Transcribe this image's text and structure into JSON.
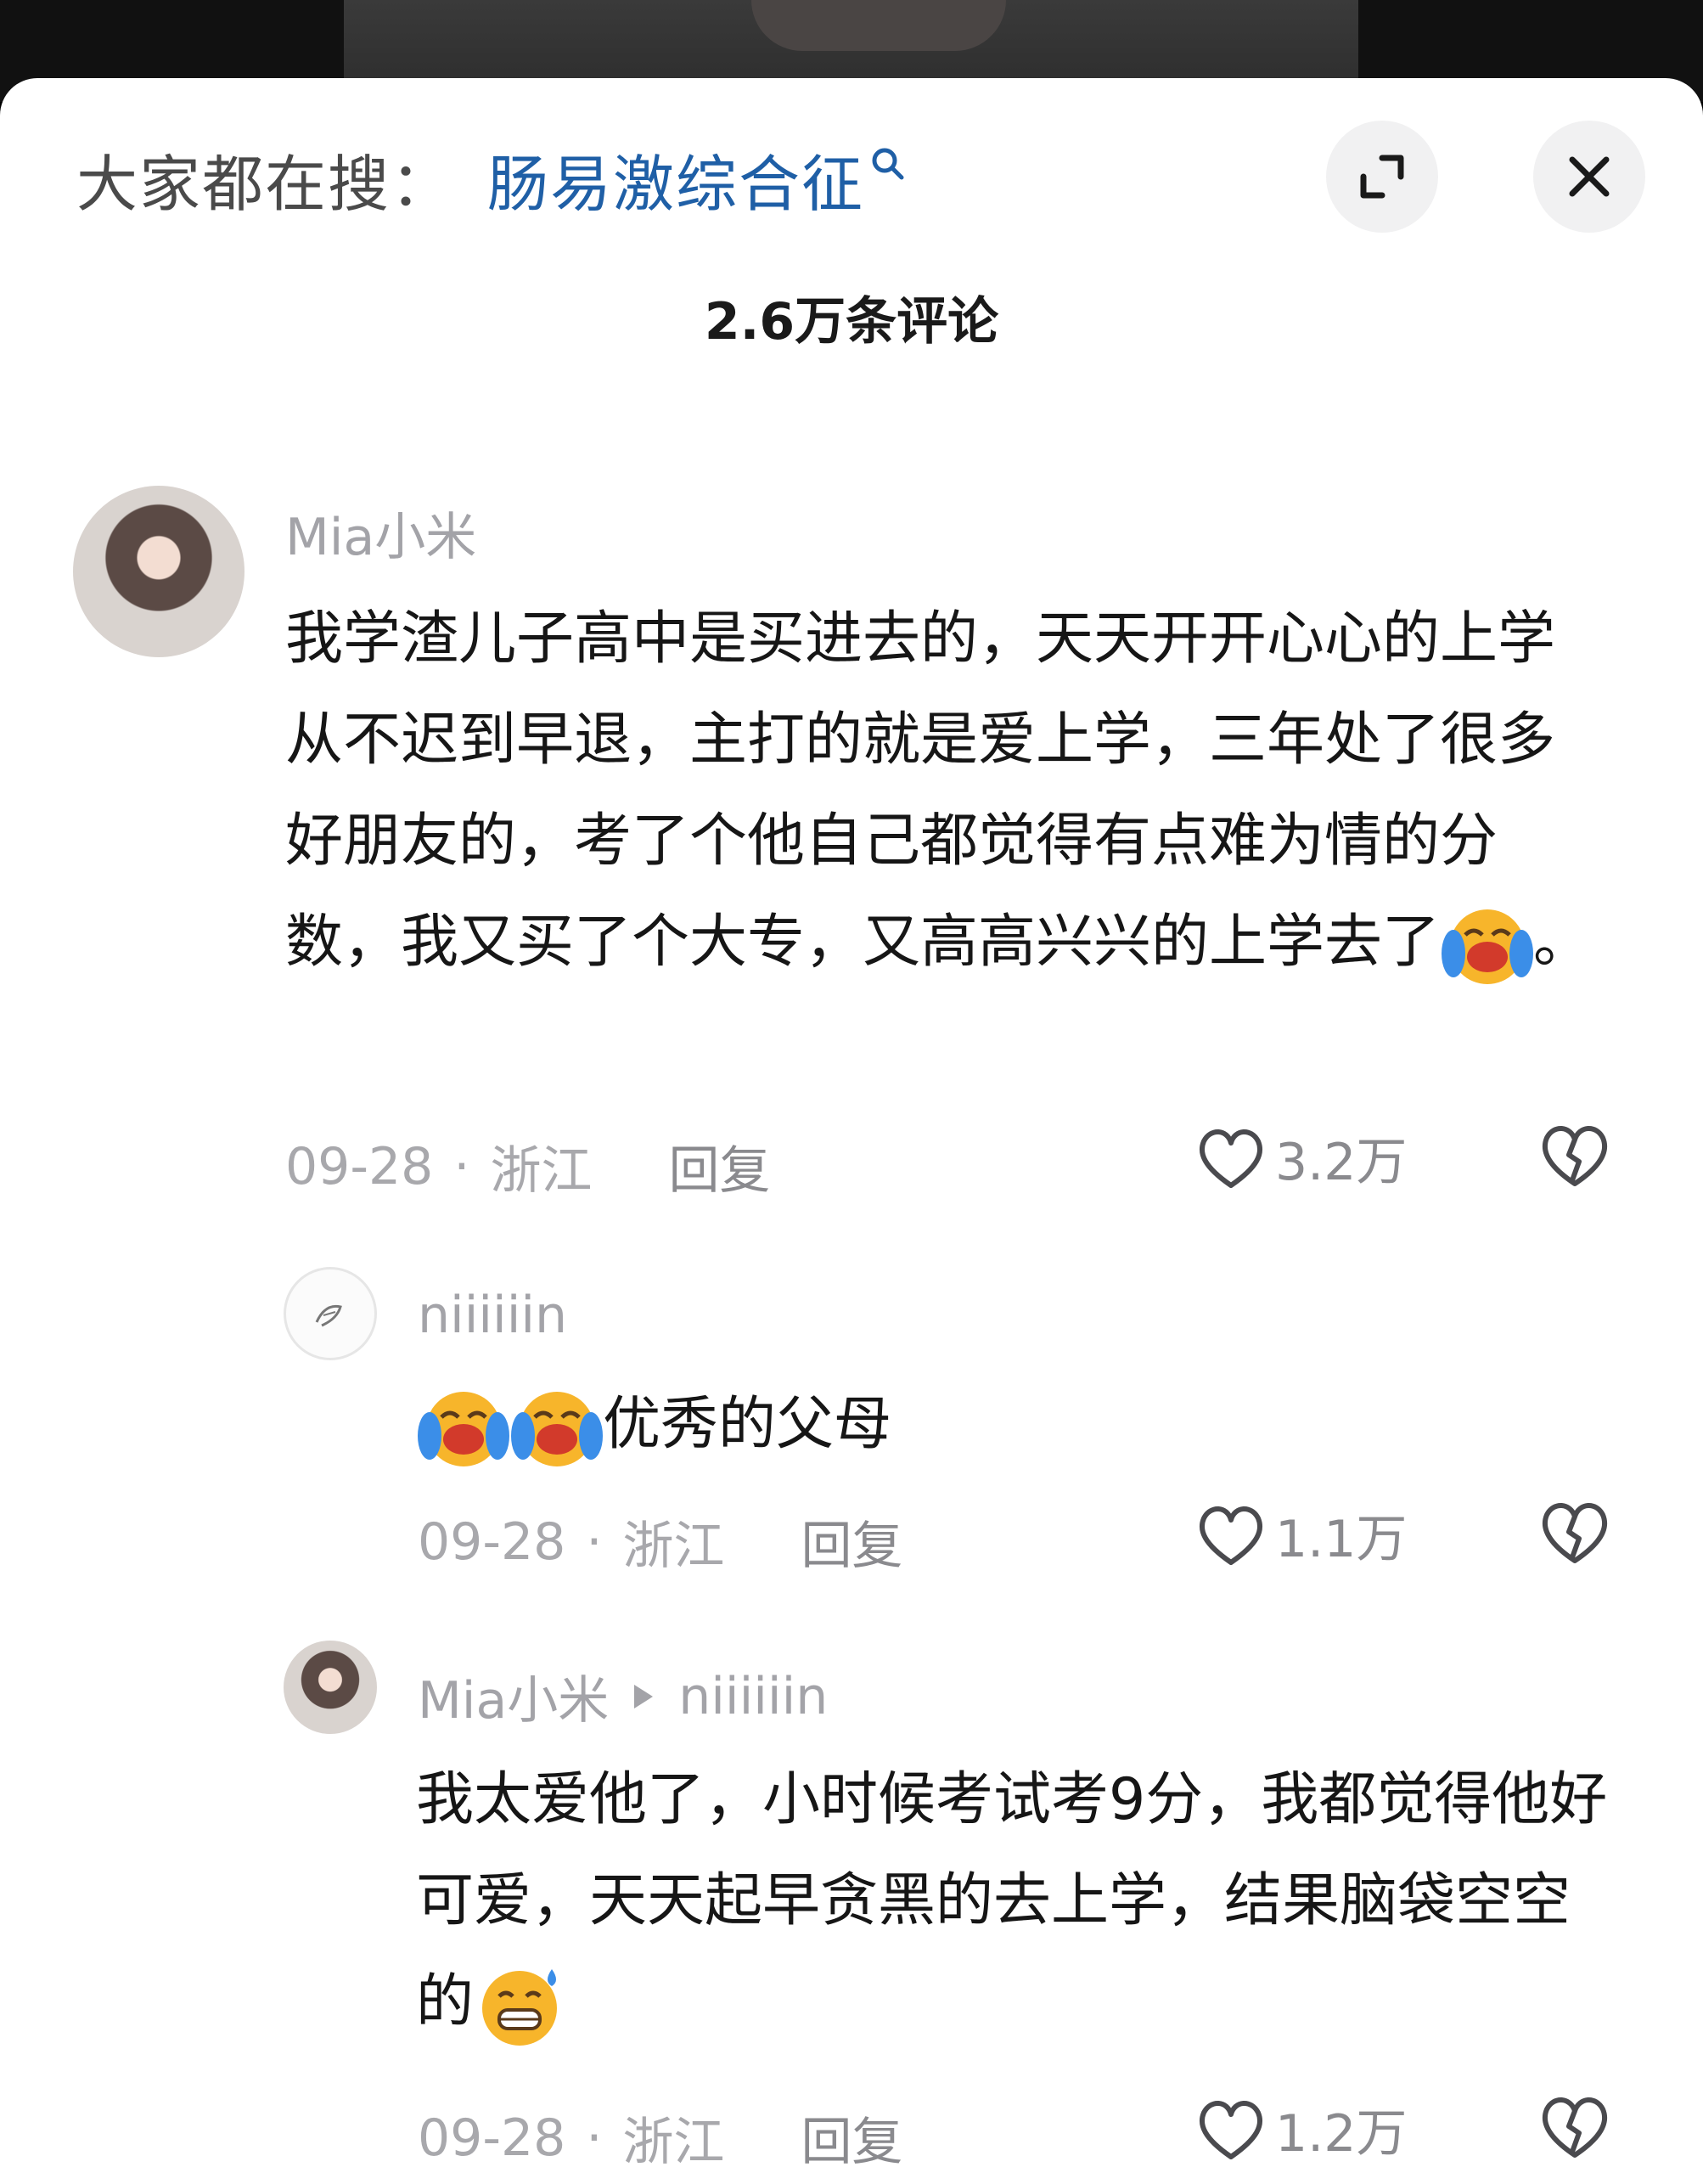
{
  "header": {
    "search_prefix": "大家都在搜：",
    "search_keyword": "肠易激综合征",
    "comment_count": "2.6万条评论"
  },
  "icons": {
    "search": "search-icon",
    "expand": "expand-icon",
    "close": "close-icon",
    "like": "heart-outline-icon",
    "dislike": "broken-heart-icon",
    "emoji_laugh_cry": "laughing-crying-emoji",
    "emoji_grin_sweat": "grinning-sweat-emoji"
  },
  "comments": [
    {
      "username": "Mia小米",
      "text": "我学渣儿子高中是买进去的，天天开开心心的上学从不迟到早退，主打的就是爱上学，三年处了很多好朋友的，考了个他自己都觉得有点难为情的分数，我又买了个大专，又高高兴兴的上学去了",
      "text_suffix": "。",
      "date": "09-28",
      "location": "浙江",
      "reply_label": "回复",
      "likes": "3.2万",
      "replies": [
        {
          "username": "niiiiiin",
          "text": "优秀的父母",
          "date": "09-28",
          "location": "浙江",
          "reply_label": "回复",
          "likes": "1.1万"
        },
        {
          "username": "Mia小米",
          "reply_to": "niiiiiin",
          "text": "我太爱他了，小时候考试考9分，我都觉得他好可爱，天天起早贪黑的去上学，结果脑袋空空的",
          "date": "09-28",
          "location": "浙江",
          "reply_label": "回复",
          "likes": "1.2万"
        }
      ]
    }
  ],
  "separator": "·"
}
